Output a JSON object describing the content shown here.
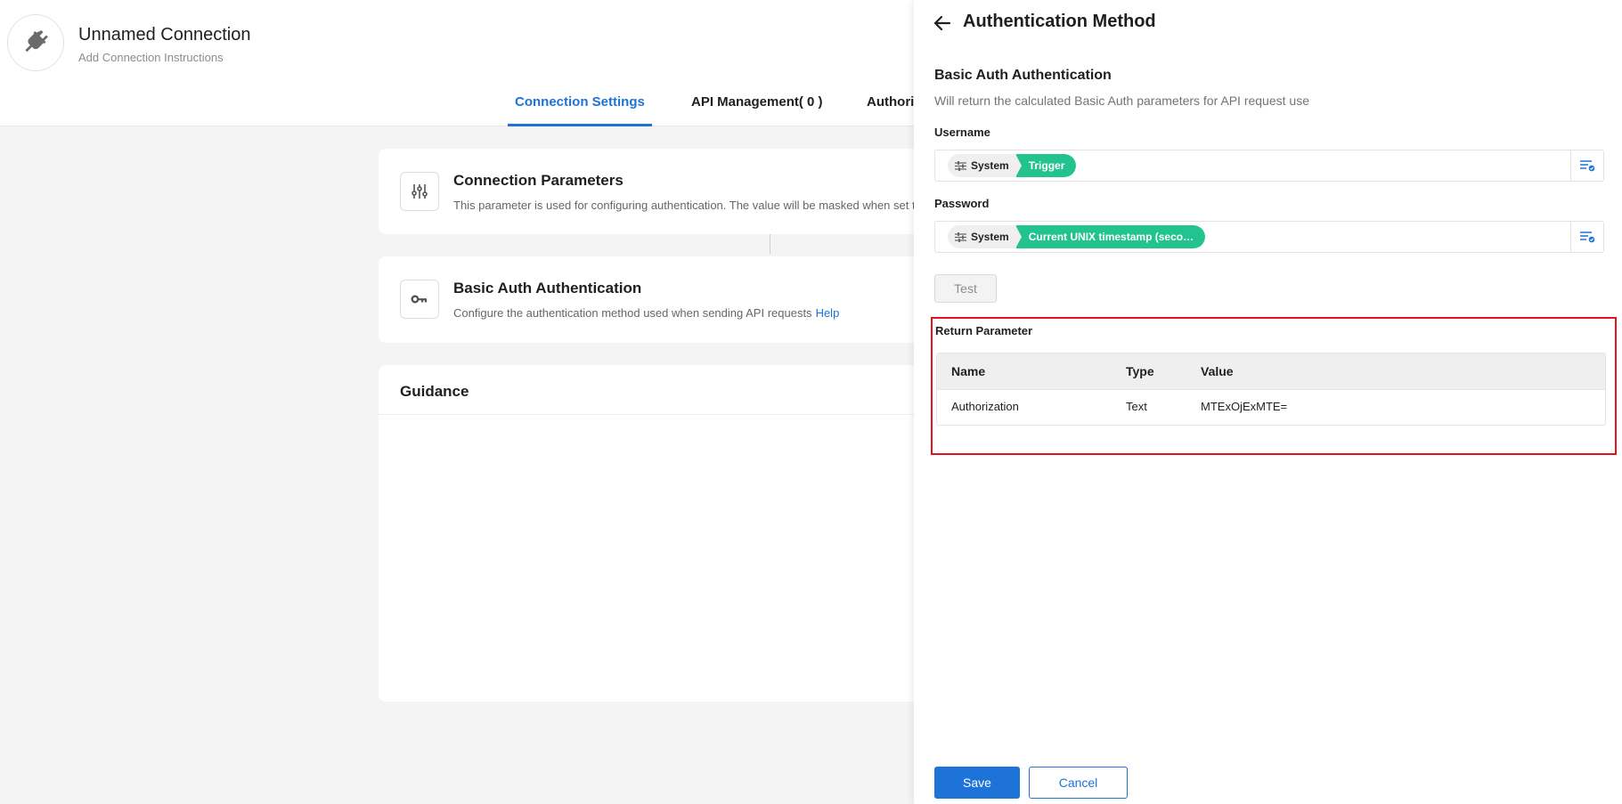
{
  "header": {
    "title": "Unnamed Connection",
    "subtitle": "Add Connection Instructions",
    "icon": "plug-icon"
  },
  "tabs": [
    {
      "label": "Connection Settings",
      "active": true
    },
    {
      "label": "API Management( 0 )",
      "active": false
    },
    {
      "label": "Authori",
      "active": false
    }
  ],
  "cards": {
    "params": {
      "title": "Connection Parameters",
      "desc": "This parameter is used for configuring authentication. The value will be masked when set t",
      "icon": "sliders-icon"
    },
    "auth": {
      "title": "Basic Auth Authentication",
      "desc": "Configure the authentication method used when sending API requests",
      "help": "Help",
      "icon": "key-icon"
    },
    "guidance": {
      "title": "Guidance"
    }
  },
  "drawer": {
    "title": "Authentication Method",
    "section_title": "Basic Auth Authentication",
    "section_desc": "Will return the calculated Basic Auth parameters for API request use",
    "username": {
      "label": "Username",
      "chip_source": "System",
      "chip_value": "Trigger"
    },
    "password": {
      "label": "Password",
      "chip_source": "System",
      "chip_value": "Current UNIX timestamp (seco…"
    },
    "test_label": "Test",
    "return": {
      "title": "Return Parameter",
      "columns": [
        "Name",
        "Type",
        "Value"
      ],
      "rows": [
        [
          "Authorization",
          "Text",
          "MTExOjExMTE="
        ]
      ]
    },
    "save_label": "Save",
    "cancel_label": "Cancel"
  },
  "colors": {
    "accent": "#1e73d8",
    "chip_green": "#22c38e",
    "highlight_red": "#e0141e"
  }
}
